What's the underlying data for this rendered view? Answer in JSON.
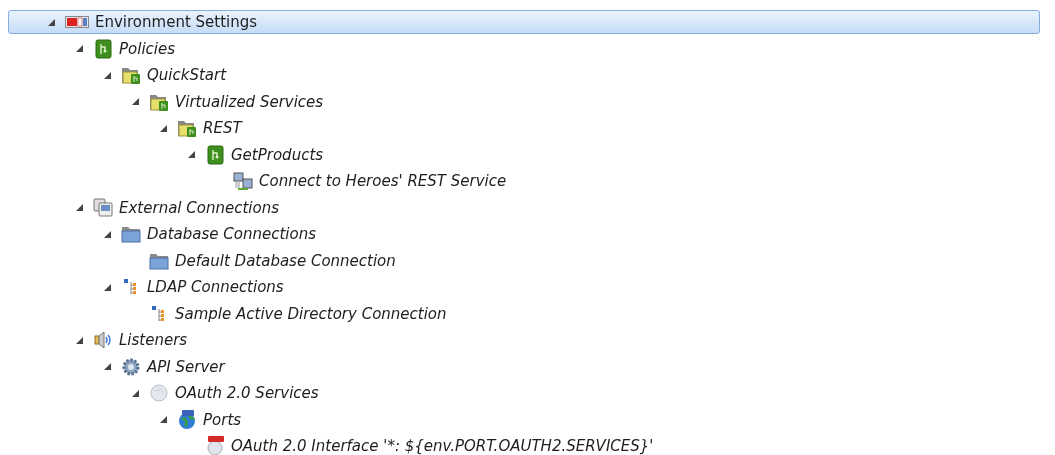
{
  "tree": [
    {
      "label": "Environment Settings",
      "kind": "settings",
      "expanded": true,
      "selected": true,
      "children": [
        {
          "label": "Policies",
          "kind": "policy",
          "expanded": true,
          "selected": false,
          "children": [
            {
              "label": "QuickStart",
              "kind": "policy-folder",
              "expanded": true,
              "selected": false,
              "children": [
                {
                  "label": "Virtualized Services",
                  "kind": "policy-folder",
                  "expanded": true,
                  "selected": false,
                  "children": [
                    {
                      "label": "REST",
                      "kind": "policy-folder",
                      "expanded": true,
                      "selected": false,
                      "children": [
                        {
                          "label": "GetProducts",
                          "kind": "policy",
                          "expanded": true,
                          "selected": false,
                          "children": [
                            {
                              "label": "Connect to Heroes' REST Service",
                              "kind": "connector",
                              "selected": false
                            }
                          ]
                        }
                      ]
                    }
                  ]
                }
              ]
            }
          ]
        },
        {
          "label": "External Connections",
          "kind": "computers",
          "expanded": true,
          "selected": false,
          "children": [
            {
              "label": "Database Connections",
              "kind": "folder",
              "expanded": true,
              "selected": false,
              "children": [
                {
                  "label": "Default Database Connection",
                  "kind": "folder",
                  "selected": false
                }
              ]
            },
            {
              "label": "LDAP Connections",
              "kind": "ldap",
              "expanded": true,
              "selected": false,
              "children": [
                {
                  "label": "Sample Active Directory Connection",
                  "kind": "ldap",
                  "selected": false
                }
              ]
            }
          ]
        },
        {
          "label": "Listeners",
          "kind": "speaker",
          "expanded": true,
          "selected": false,
          "children": [
            {
              "label": "API Server",
              "kind": "gear",
              "expanded": true,
              "selected": false,
              "children": [
                {
                  "label": "OAuth 2.0 Services",
                  "kind": "globe-grey",
                  "expanded": true,
                  "selected": false,
                  "children": [
                    {
                      "label": "Ports",
                      "kind": "globe-http",
                      "expanded": true,
                      "selected": false,
                      "children": [
                        {
                          "label": "OAuth 2.0 Interface '*: ${env.PORT.OAUTH2.SERVICES}'",
                          "kind": "https",
                          "selected": false
                        }
                      ]
                    }
                  ]
                }
              ]
            }
          ]
        }
      ]
    }
  ]
}
